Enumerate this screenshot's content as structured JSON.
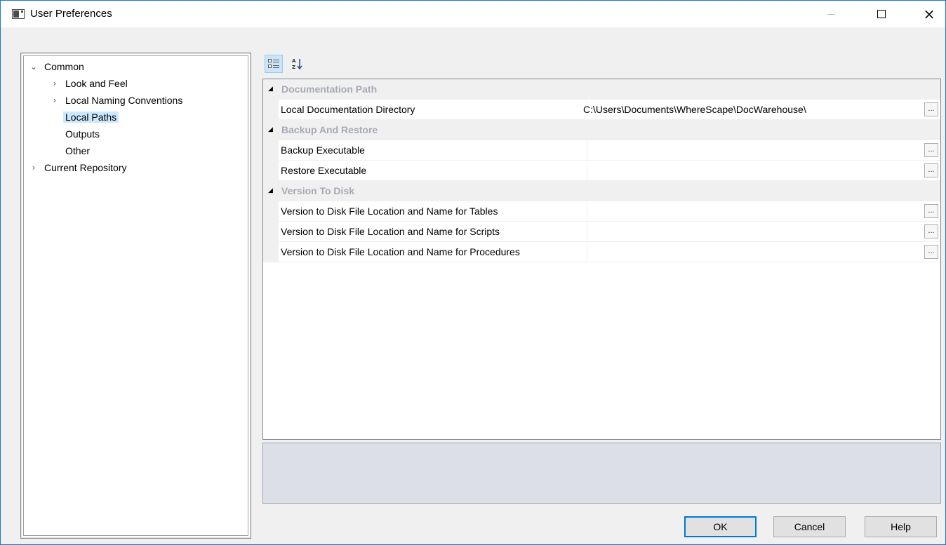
{
  "window": {
    "title": "User Preferences",
    "controls": {
      "minimize": "minimize",
      "maximize": "maximize",
      "close": "×"
    }
  },
  "tree": {
    "items": [
      {
        "label": "Common",
        "expander": "expanded",
        "level": 0
      },
      {
        "label": "Look and Feel",
        "expander": "collapsed",
        "level": 1
      },
      {
        "label": "Local Naming Conventions",
        "expander": "collapsed",
        "level": 1
      },
      {
        "label": "Local Paths",
        "expander": "none",
        "level": 1,
        "selected": true
      },
      {
        "label": "Outputs",
        "expander": "none",
        "level": 1
      },
      {
        "label": "Other",
        "expander": "none",
        "level": 1
      },
      {
        "label": "Current Repository",
        "expander": "collapsed",
        "level": 0
      }
    ]
  },
  "toolbar": {
    "categorized_icon": "categorized-icon",
    "alphabetical_icon": "sort-alphabetical-icon",
    "categorized_active": true
  },
  "property_grid": {
    "categories": [
      {
        "name": "Documentation Path",
        "properties": [
          {
            "name": "Local Documentation Directory",
            "value": "C:\\Users\\Documents\\WhereScape\\DocWarehouse\\"
          }
        ]
      },
      {
        "name": "Backup And Restore",
        "properties": [
          {
            "name": "Backup Executable",
            "value": ""
          },
          {
            "name": "Restore Executable",
            "value": ""
          }
        ]
      },
      {
        "name": "Version To Disk",
        "properties": [
          {
            "name": "Version to Disk File Location and Name for Tables",
            "value": ""
          },
          {
            "name": "Version to Disk File Location and Name for Scripts",
            "value": ""
          },
          {
            "name": "Version to Disk File Location and Name for Procedures",
            "value": ""
          }
        ]
      }
    ],
    "ellipsis_label": "..."
  },
  "buttons": {
    "ok": "OK",
    "cancel": "Cancel",
    "help": "Help"
  },
  "colors": {
    "selection": "#cce8ff",
    "category_text": "#a6aab3",
    "accent": "#0078d7"
  }
}
